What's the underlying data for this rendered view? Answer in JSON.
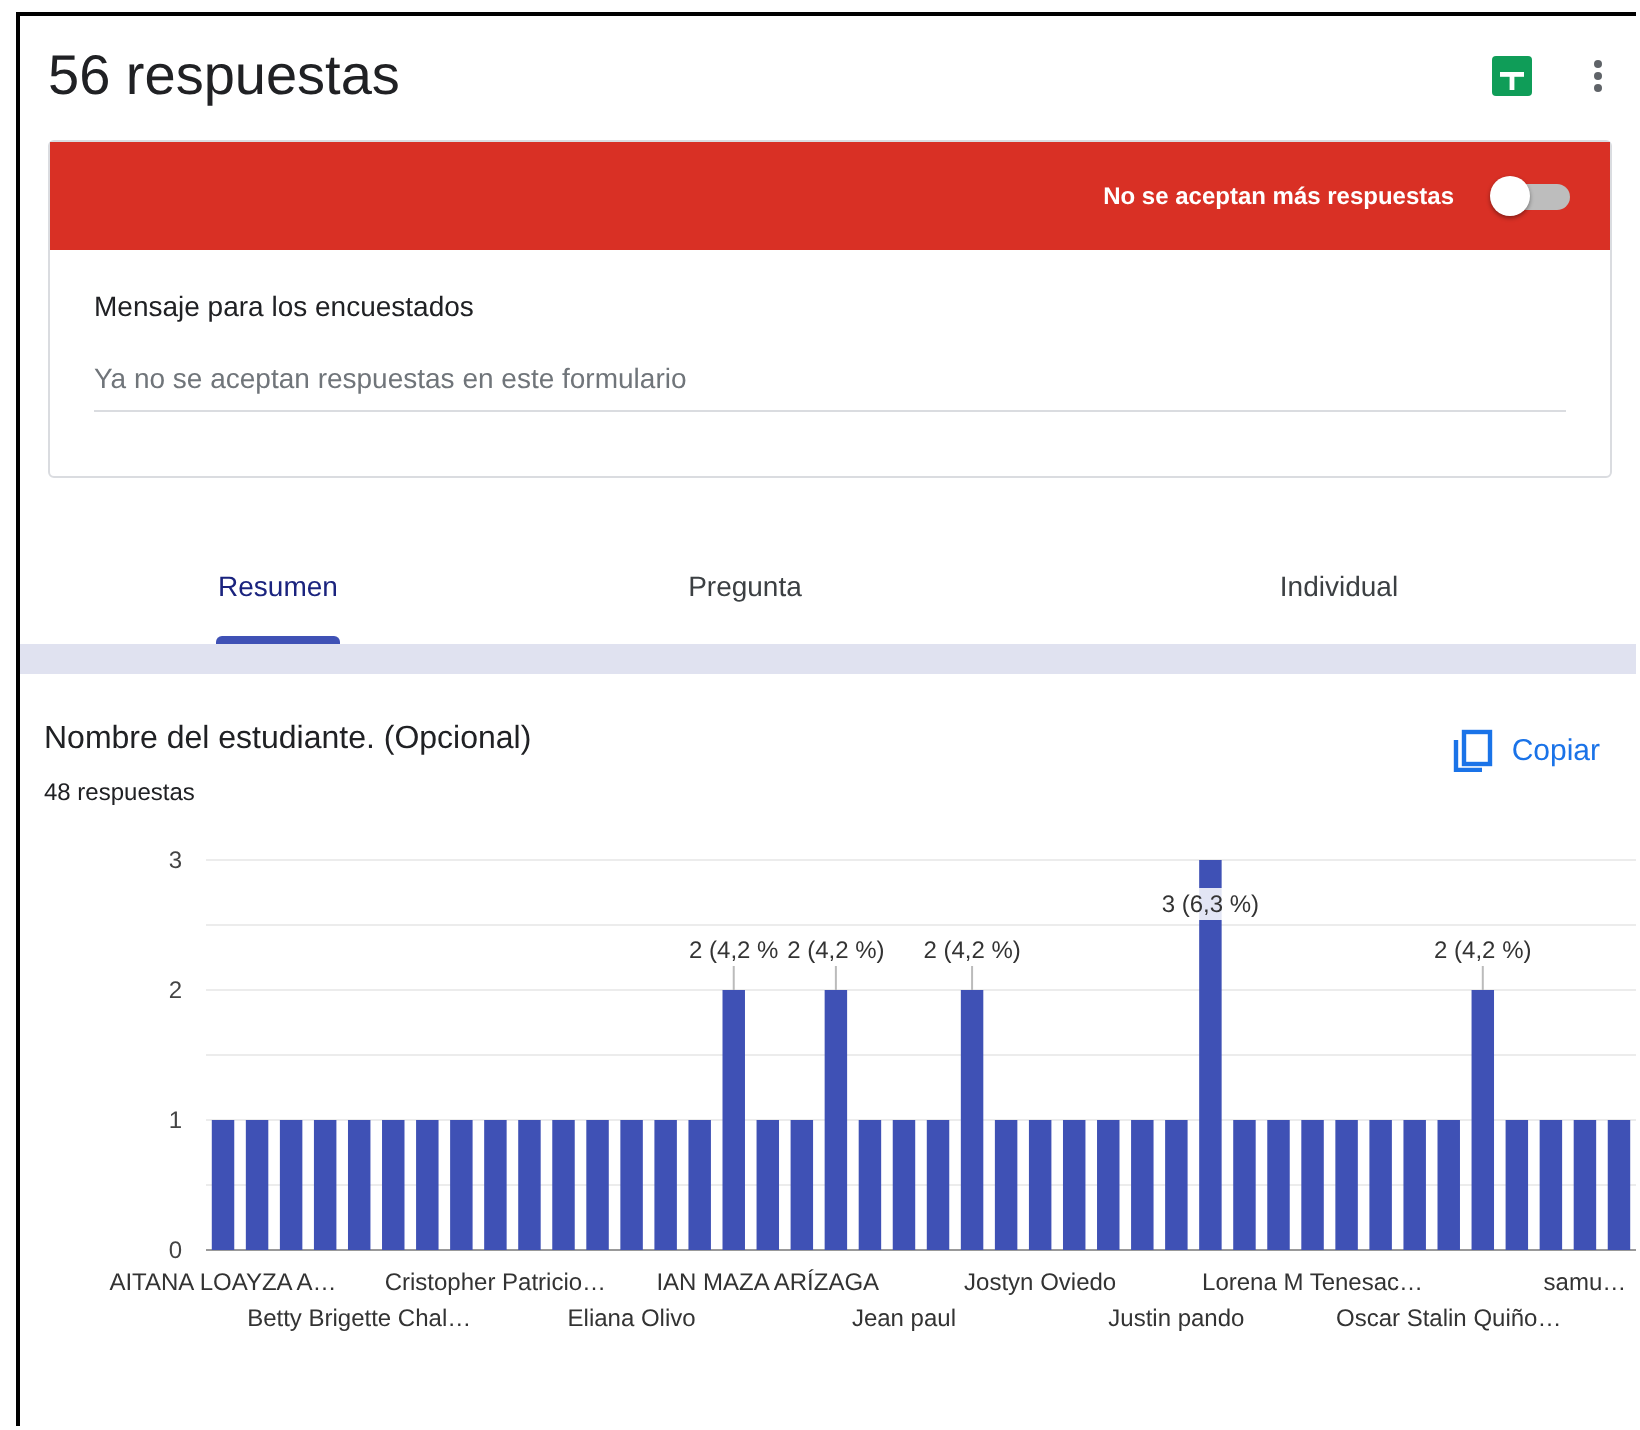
{
  "header": {
    "title": "56 respuestas"
  },
  "banner": {
    "text": "No se aceptan más respuestas",
    "accepting": false
  },
  "message": {
    "label": "Mensaje para los encuestados",
    "value": "Ya no se aceptan respuestas en este formulario"
  },
  "tabs": [
    {
      "label": "Resumen",
      "selected": true
    },
    {
      "label": "Pregunta",
      "selected": false
    },
    {
      "label": "Individual",
      "selected": false
    }
  ],
  "question": {
    "title": "Nombre del estudiante. (Opcional)",
    "count": "48 respuestas",
    "copy_button": "Copiar",
    "chart_data": {
      "type": "bar",
      "ylim": [
        0,
        3
      ],
      "yticks": [
        0,
        1,
        2,
        3
      ],
      "categories": [
        "AITANA LOAYZA A…",
        null,
        null,
        null,
        "Betty Brigette Chal…",
        null,
        null,
        null,
        "Cristopher Patricio…",
        null,
        null,
        null,
        "Eliana Olivo",
        null,
        null,
        null,
        "IAN MAZA ARÍZAGA",
        null,
        null,
        null,
        "Jean paul",
        null,
        null,
        null,
        "Jostyn Oviedo",
        null,
        null,
        null,
        "Justin pando",
        null,
        null,
        null,
        "Lorena M Tenesac…",
        null,
        null,
        null,
        "Oscar Stalin Quiño…",
        null,
        null,
        null,
        "samu…",
        null
      ],
      "series": [
        {
          "color": "#3f51b5",
          "values": [
            1,
            1,
            1,
            1,
            1,
            1,
            1,
            1,
            1,
            1,
            1,
            1,
            1,
            1,
            1,
            2,
            1,
            1,
            2,
            1,
            1,
            1,
            2,
            1,
            1,
            1,
            1,
            1,
            1,
            3,
            1,
            1,
            1,
            1,
            1,
            1,
            1,
            2,
            1,
            1,
            1,
            1
          ]
        }
      ],
      "value_labels": [
        null,
        null,
        null,
        null,
        null,
        null,
        null,
        null,
        null,
        null,
        null,
        null,
        null,
        null,
        null,
        "2 (4,2 %",
        null,
        null,
        "2 (4,2 %)",
        null,
        null,
        null,
        "2 (4,2 %)",
        null,
        null,
        null,
        null,
        null,
        null,
        "3 (6,3 %)",
        null,
        null,
        null,
        null,
        null,
        null,
        null,
        "2 (4,2 %)",
        null,
        null,
        null,
        null
      ]
    }
  }
}
